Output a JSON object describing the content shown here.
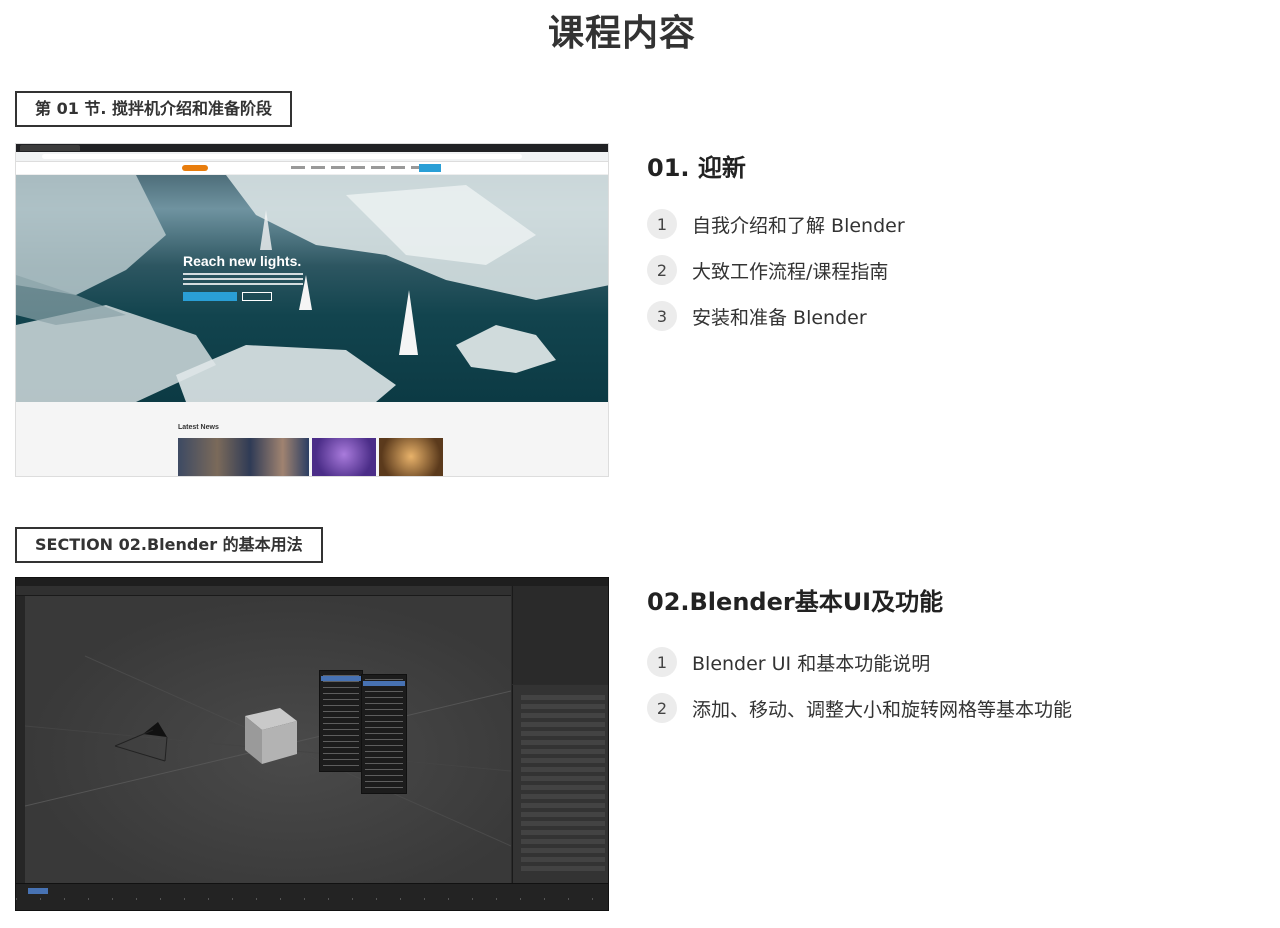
{
  "page_title": "课程内容",
  "sections": [
    {
      "tag": "第 01 节. 搅拌机介绍和准备阶段",
      "lesson_title": "01. 迎新",
      "items": [
        {
          "num": "1",
          "text": "自我介绍和了解 Blender"
        },
        {
          "num": "2",
          "text": "大致工作流程/课程指南"
        },
        {
          "num": "3",
          "text": "安装和准备 Blender"
        }
      ],
      "screenshot": {
        "hero_heading": "Reach new lights.",
        "news_label": "Latest News"
      }
    },
    {
      "tag": "SECTION 02.Blender 的基本用法",
      "lesson_title": "02.Blender基本UI及功能",
      "items": [
        {
          "num": "1",
          "text": "Blender UI 和基本功能说明"
        },
        {
          "num": "2",
          "text": "添加、移动、调整大小和旋转网格等基本功能"
        }
      ]
    }
  ]
}
